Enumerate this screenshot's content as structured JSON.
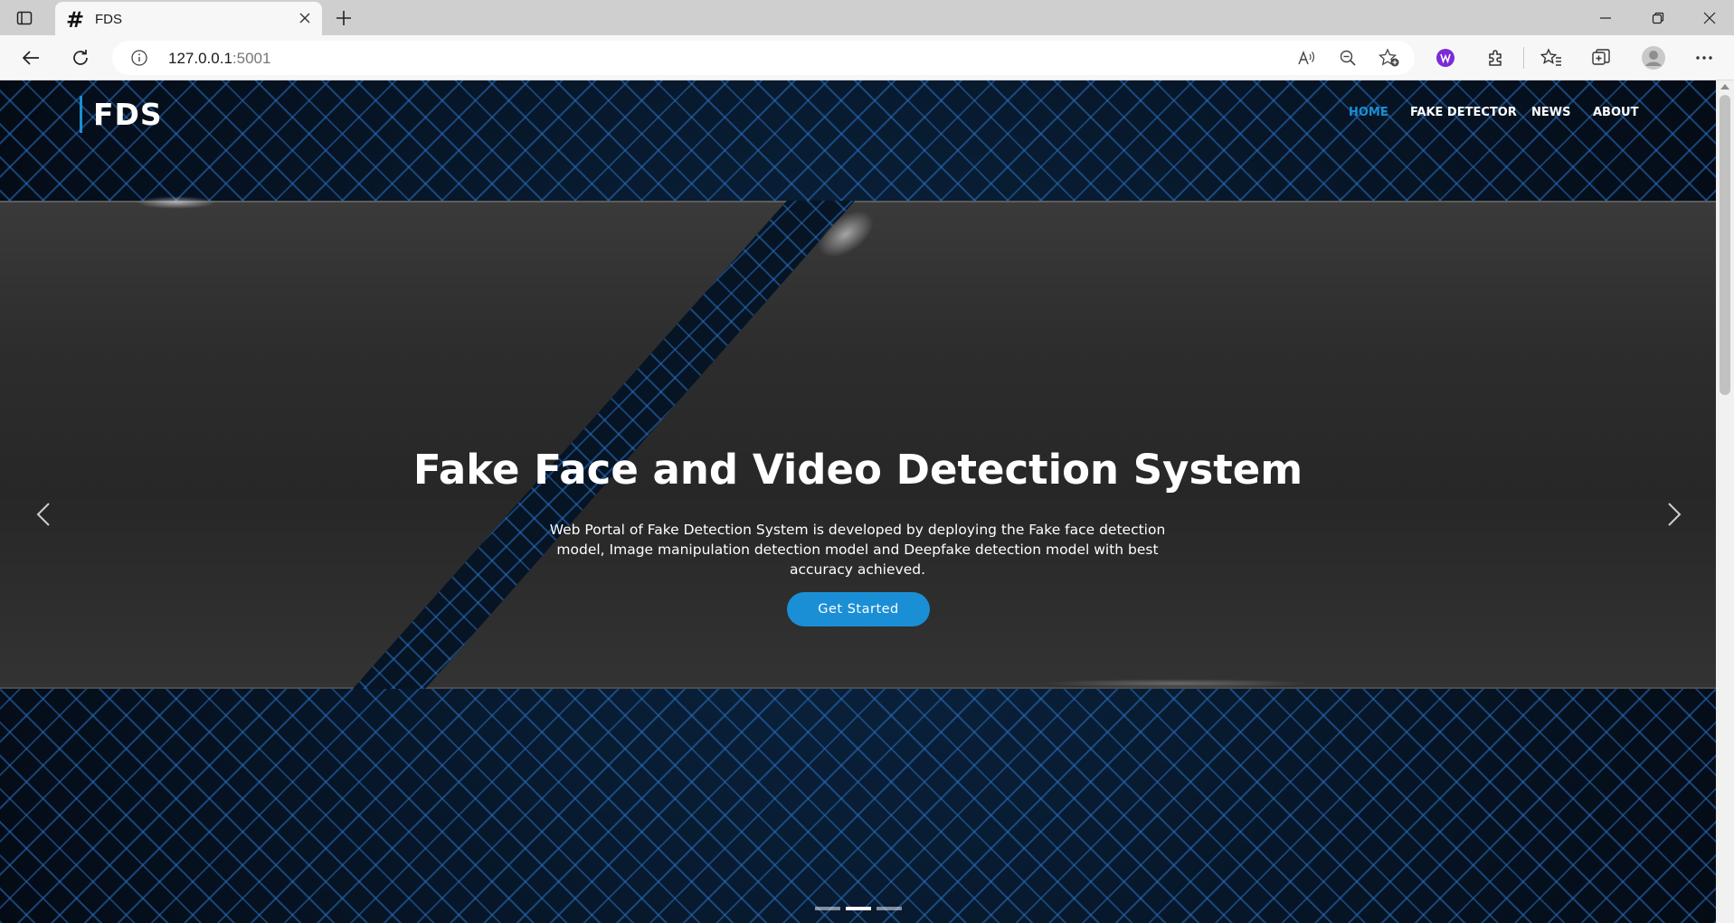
{
  "browser": {
    "tab": {
      "favicon": "#",
      "title": "FDS"
    },
    "url_host": "127.0.0.1",
    "url_port": ":5001",
    "icons": [
      "tab-actions-icon",
      "close-icon",
      "plus-icon",
      "minimize-icon",
      "restore-icon",
      "close-window-icon",
      "back-icon",
      "refresh-icon",
      "info-icon",
      "read-aloud-icon",
      "zoom-out-icon",
      "add-favorite-icon",
      "extension-icon",
      "extensions-icon",
      "favorites-icon",
      "collections-icon",
      "profile-icon",
      "more-icon"
    ],
    "accent_color": "#1a8fd6"
  },
  "site": {
    "brand": "FDS",
    "nav": [
      {
        "label": "HOME",
        "active": true
      },
      {
        "label": "FAKE DETECTOR",
        "active": false
      },
      {
        "label": "NEWS",
        "active": false
      },
      {
        "label": "ABOUT",
        "active": false
      }
    ],
    "hero": {
      "title": "Fake Face and Video Detection System",
      "description": "Web Portal of Fake Detection System is developed by deploying the Fake face detection model, Image manipulation detection model and Deepfake detection model with best accuracy achieved.",
      "cta": "Get Started"
    },
    "carousel": {
      "slides": 3,
      "active_slide": 2
    }
  }
}
